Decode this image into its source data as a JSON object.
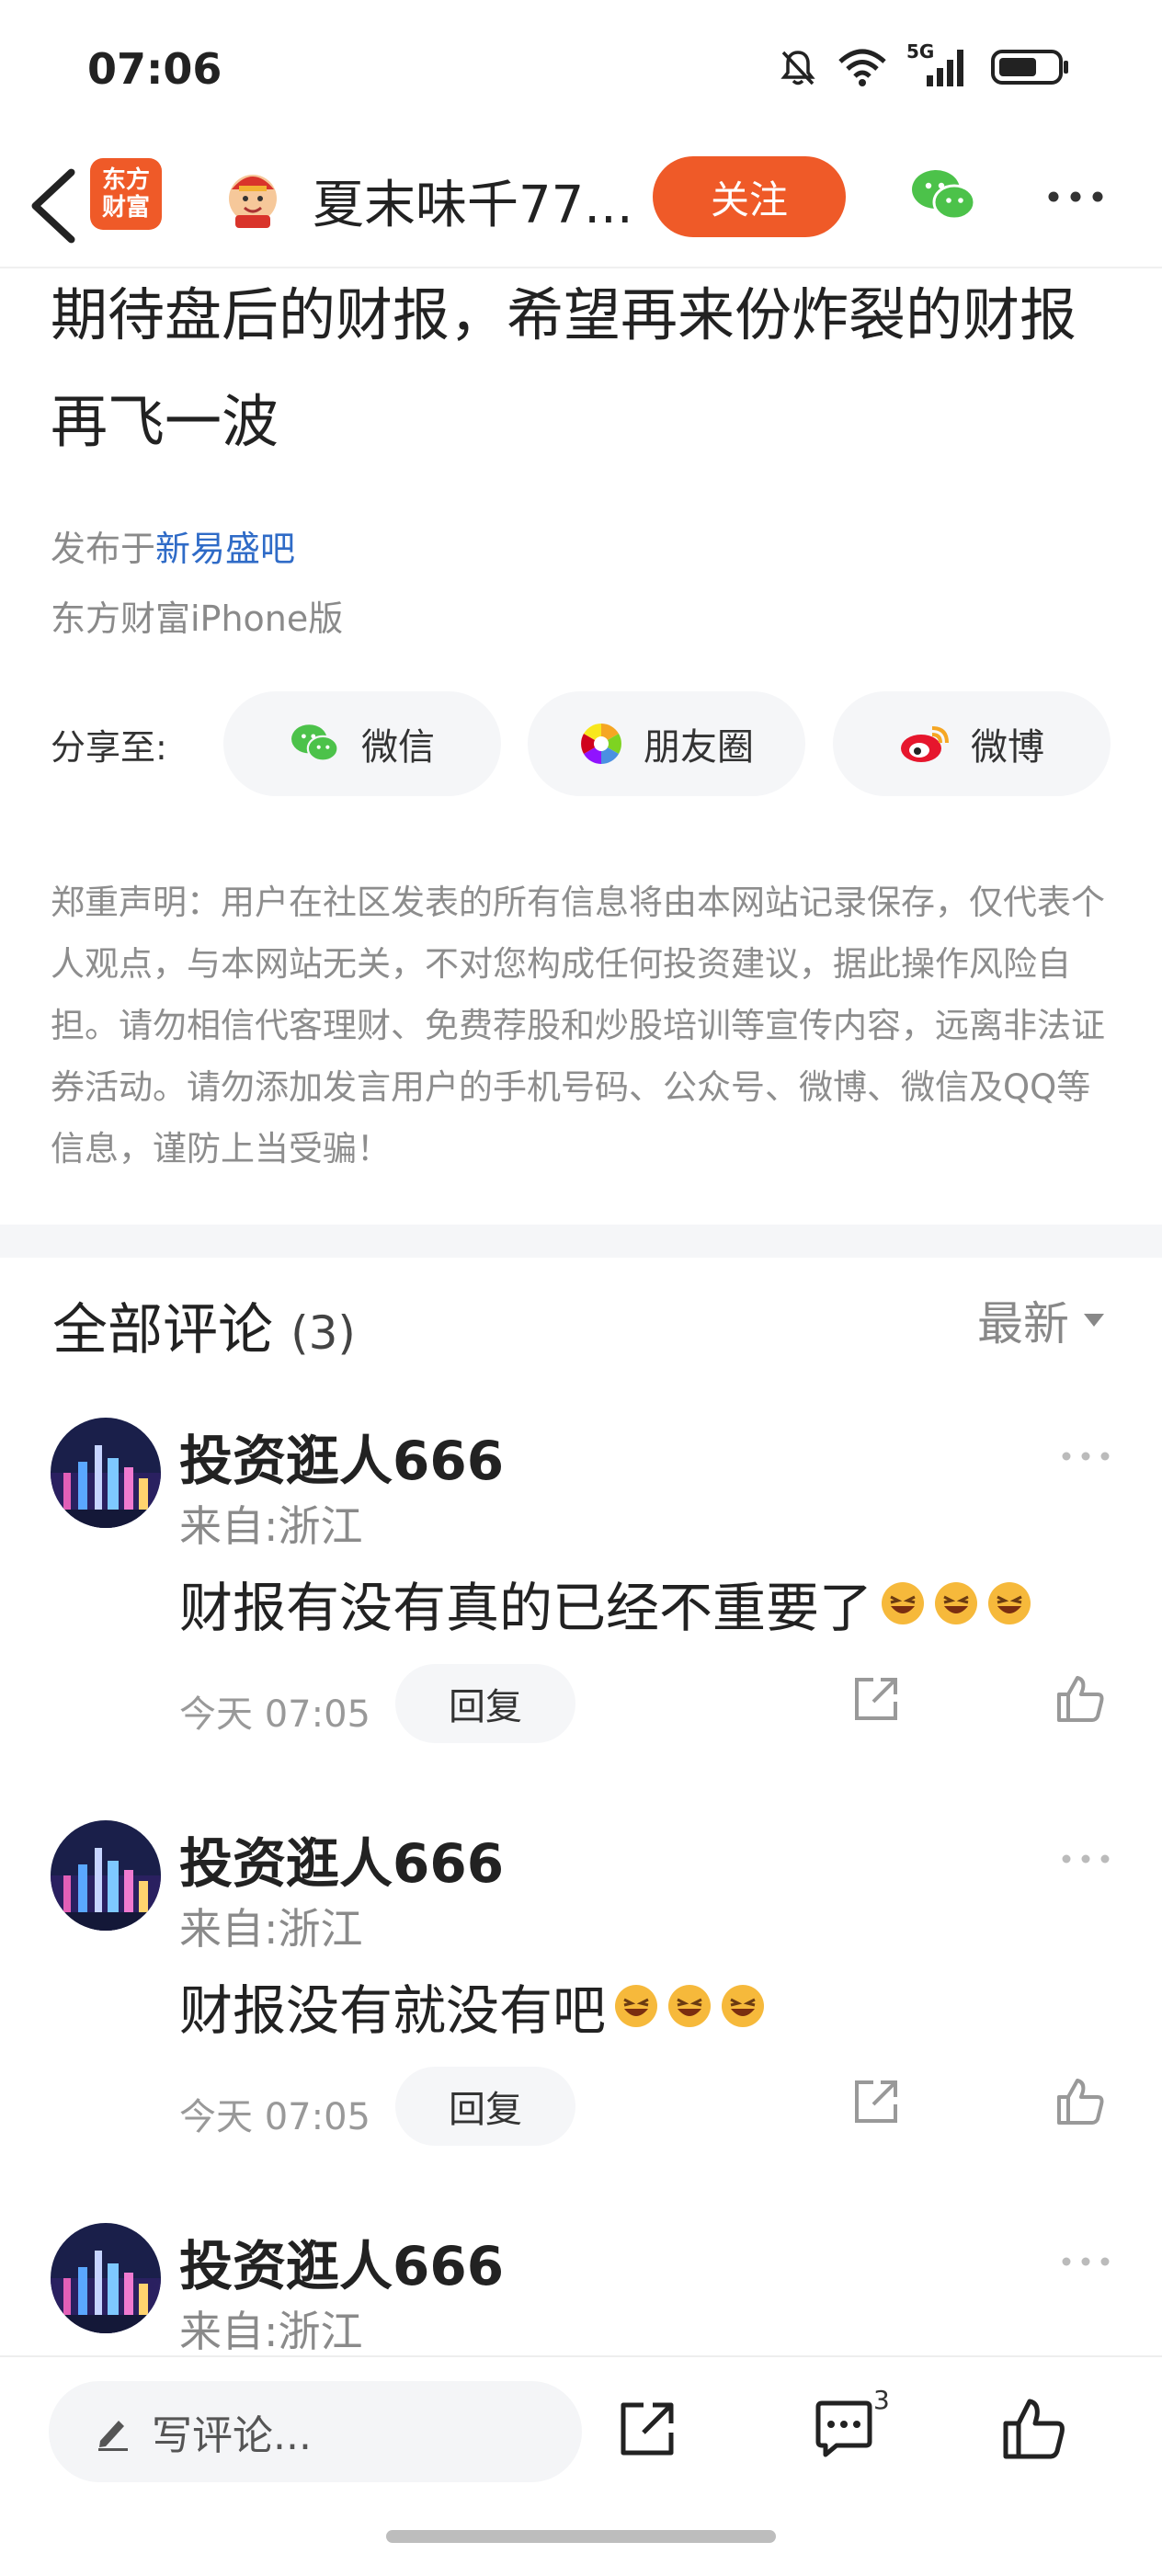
{
  "status_bar": {
    "time": "07:06",
    "network": "5G"
  },
  "header": {
    "app_logo": "东方\n财富",
    "title": "夏末味千77...",
    "follow_label": "关注"
  },
  "article": {
    "title": "期待盘后的财报，希望再来份炸裂的财报再飞一波",
    "published_prefix": "发布于",
    "published_bar": "新易盛吧",
    "source": "东方财富iPhone版"
  },
  "share": {
    "label": "分享至:",
    "options": [
      {
        "label": "微信",
        "icon": "wechat-icon"
      },
      {
        "label": "朋友圈",
        "icon": "moments-icon"
      },
      {
        "label": "微博",
        "icon": "weibo-icon"
      }
    ]
  },
  "disclaimer": "郑重声明：用户在社区发表的所有信息将由本网站记录保存，仅代表个人观点，与本网站无关，不对您构成任何投资建议，据此操作风险自担。请勿相信代客理财、免费荐股和炒股培训等宣传内容，远离非法证券活动。请勿添加发言用户的手机号码、公众号、微博、微信及QQ等信息，谨防上当受骗！",
  "comments_section": {
    "title": "全部评论",
    "count": "(3)",
    "sort_label": "最新"
  },
  "comments": [
    {
      "name": "投资逛人666",
      "location": "来自:浙江",
      "text": "财报有没有真的已经不重要了",
      "emoji_count": 3,
      "time": "今天 07:05",
      "reply_label": "回复"
    },
    {
      "name": "投资逛人666",
      "location": "来自:浙江",
      "text": "财报没有就没有吧",
      "emoji_count": 3,
      "time": "今天 07:05",
      "reply_label": "回复"
    },
    {
      "name": "投资逛人666",
      "location": "来自:浙江"
    }
  ],
  "bottom_bar": {
    "write_placeholder": "写评论...",
    "comment_badge": "3"
  },
  "colors": {
    "brand": "#ef5a28",
    "link": "#2f6bc7",
    "muted": "#8a8a8a"
  }
}
